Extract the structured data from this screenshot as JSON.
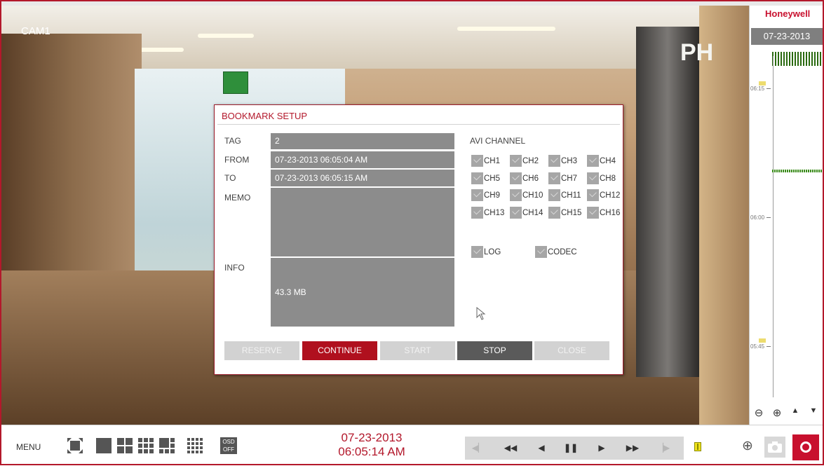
{
  "camera": {
    "label": "CAM1",
    "sign_text": "PH"
  },
  "timeline": {
    "brand": "Honeywell",
    "date": "07-23-2013",
    "ticks": [
      "06:15",
      "06:00",
      "05:45"
    ],
    "controls": [
      "zoom-out-icon",
      "zoom-in-icon",
      "up-arrow-icon",
      "down-arrow-icon"
    ]
  },
  "dialog": {
    "title": "BOOKMARK SETUP",
    "tag_label": "TAG",
    "tag_value": "2",
    "from_label": "FROM",
    "from_value": "07-23-2013  06:05:04 AM",
    "to_label": "TO",
    "to_value": "07-23-2013  06:05:15 AM",
    "memo_label": "MEMO",
    "memo_value": "",
    "info_label": "INFO",
    "info_value": "43.3 MB",
    "avi_title": "AVI CHANNEL",
    "channels": [
      "CH1",
      "CH2",
      "CH3",
      "CH4",
      "CH5",
      "CH6",
      "CH7",
      "CH8",
      "CH9",
      "CH10",
      "CH11",
      "CH12",
      "CH13",
      "CH14",
      "CH15",
      "CH16"
    ],
    "log_label": "LOG",
    "codec_label": "CODEC",
    "buttons": {
      "reserve": "RESERVE",
      "continue": "CONTINUE",
      "start": "START",
      "stop": "STOP",
      "close": "CLOSE"
    },
    "colors": {
      "accent": "#b3182b",
      "continue": "#b0101e",
      "stop": "#5a5a5a",
      "disabled": "#d2d2d2"
    }
  },
  "bottom": {
    "menu_label": "MENU",
    "osd_line1": "OSD",
    "osd_line2": "OFF",
    "date": "07-23-2013",
    "time": "06:05:14 AM",
    "playback": [
      "prev-frame-icon",
      "fast-rewind-icon",
      "rewind-icon",
      "pause-icon",
      "play-icon",
      "fast-forward-icon",
      "next-frame-icon"
    ]
  }
}
